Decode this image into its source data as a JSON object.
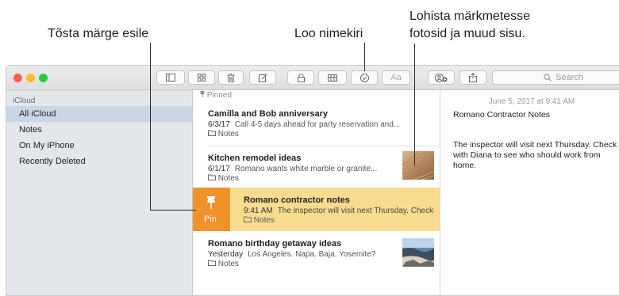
{
  "callouts": {
    "highlight": "Tõsta märge esile",
    "checklist": "Loo nimekiri",
    "media_line1": "Lohista märkmetesse",
    "media_line2": "fotosid ja muud sisu."
  },
  "window": {
    "traffic_lights": [
      "#ff5f57",
      "#febc2e",
      "#28c840"
    ],
    "toolbar": {
      "search_placeholder": "Search",
      "format_label": "Aa"
    }
  },
  "sidebar": {
    "section": "iCloud",
    "items": [
      {
        "label": "All iCloud",
        "selected": true
      },
      {
        "label": "Notes",
        "selected": false
      },
      {
        "label": "On My iPhone",
        "selected": false
      },
      {
        "label": "Recently Deleted",
        "selected": false
      }
    ]
  },
  "notes_list": {
    "pinned_header": "Pinned",
    "pin_action_label": "Pin",
    "notes": [
      {
        "title": "Camilla and Bob anniversary",
        "date": "6/3/17",
        "preview": "Call 4-5 days ahead for party reservation and...",
        "folder": "Notes"
      },
      {
        "title": "Kitchen remodel ideas",
        "date": "6/1/17",
        "preview": "Romano wants white marble or granite...",
        "folder": "Notes"
      },
      {
        "title": "Romano contractor notes",
        "date": "9:41 AM",
        "preview": "The inspector will visit next Thursday. Check",
        "folder": "Notes"
      },
      {
        "title": "Romano birthday getaway ideas",
        "date": "Yesterday",
        "preview": "Los Angeles. Napa. Baja. Yosemite?",
        "folder": "Notes"
      }
    ]
  },
  "detail": {
    "date": "June 5, 2017 at 9:41 AM",
    "title": "Romano Contractor Notes",
    "body": "The inspector will visit next Thursday. Check with Diana to see who should work from home."
  }
}
